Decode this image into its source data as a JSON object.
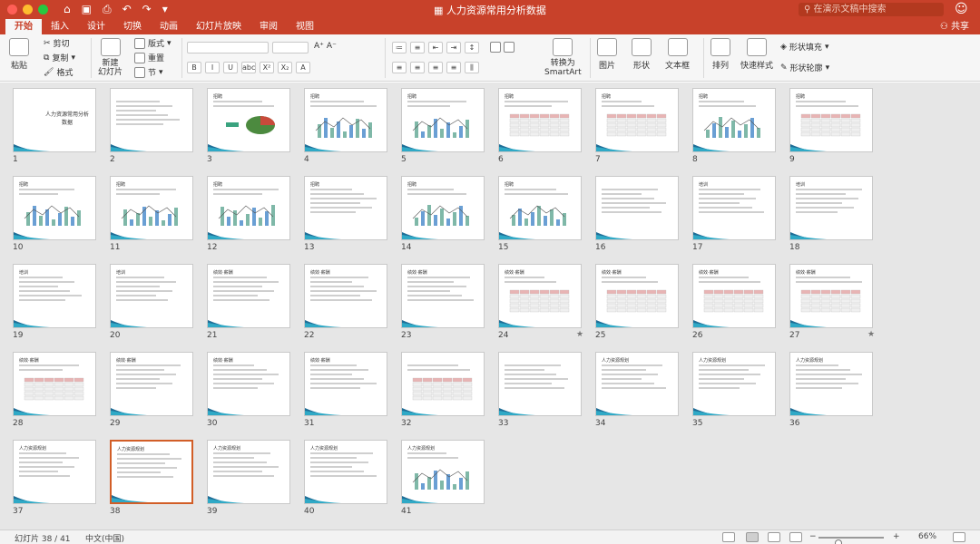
{
  "window": {
    "title": "人力资源常用分析数据",
    "search_placeholder": "在演示文稿中搜索",
    "traffic_colors": [
      "#ff5f57",
      "#febc2e",
      "#28c840"
    ]
  },
  "quick_access": [
    "home-icon",
    "save-icon",
    "print-icon",
    "undo-icon",
    "redo-icon",
    "customize-icon"
  ],
  "tabs": [
    "开始",
    "插入",
    "设计",
    "切换",
    "动画",
    "幻灯片放映",
    "审阅",
    "视图"
  ],
  "active_tab": 0,
  "share_label": "共享",
  "ribbon": {
    "paste": "粘贴",
    "cut": "剪切",
    "copy": "复制",
    "format": "格式",
    "new_slide_line1": "新建",
    "new_slide_line2": "幻灯片",
    "layout": "版式",
    "reset": "重置",
    "section": "节",
    "convert_line1": "转换为",
    "convert_line2": "SmartArt",
    "picture": "图片",
    "shape": "形状",
    "textbox": "文本框",
    "arrange": "排列",
    "quick_styles": "快速样式",
    "shape_fill": "形状填充",
    "shape_outline": "形状轮廓",
    "font_buttons": [
      "B",
      "I",
      "U",
      "abc",
      "X²",
      "X₂"
    ]
  },
  "slides": [
    {
      "num": "1",
      "title": "人力资源常用分析数据",
      "type": "title"
    },
    {
      "num": "2",
      "title": "",
      "type": "text"
    },
    {
      "num": "3",
      "title": "招聘",
      "type": "pie"
    },
    {
      "num": "4",
      "title": "招聘",
      "type": "chart"
    },
    {
      "num": "5",
      "title": "招聘",
      "type": "chart"
    },
    {
      "num": "6",
      "title": "招聘",
      "type": "table"
    },
    {
      "num": "7",
      "title": "招聘",
      "type": "table"
    },
    {
      "num": "8",
      "title": "招聘",
      "type": "chart"
    },
    {
      "num": "9",
      "title": "招聘",
      "type": "table"
    },
    {
      "num": "10",
      "title": "招聘",
      "type": "chart"
    },
    {
      "num": "11",
      "title": "招聘",
      "type": "chart"
    },
    {
      "num": "12",
      "title": "招聘",
      "type": "chart"
    },
    {
      "num": "13",
      "title": "招聘",
      "type": "text"
    },
    {
      "num": "14",
      "title": "招聘",
      "type": "chart"
    },
    {
      "num": "15",
      "title": "招聘",
      "type": "chart"
    },
    {
      "num": "16",
      "title": "",
      "type": "text"
    },
    {
      "num": "17",
      "title": "培训",
      "type": "text"
    },
    {
      "num": "18",
      "title": "培训",
      "type": "text"
    },
    {
      "num": "19",
      "title": "培训",
      "type": "text"
    },
    {
      "num": "20",
      "title": "培训",
      "type": "text"
    },
    {
      "num": "21",
      "title": "绩效·薪酬",
      "type": "text"
    },
    {
      "num": "22",
      "title": "绩效·薪酬",
      "type": "text"
    },
    {
      "num": "23",
      "title": "绩效·薪酬",
      "type": "text"
    },
    {
      "num": "24",
      "title": "绩效·薪酬",
      "type": "table",
      "star": true
    },
    {
      "num": "25",
      "title": "绩效·薪酬",
      "type": "table"
    },
    {
      "num": "26",
      "title": "绩效·薪酬",
      "type": "table"
    },
    {
      "num": "27",
      "title": "绩效·薪酬",
      "type": "table",
      "star": true
    },
    {
      "num": "28",
      "title": "绩效·薪酬",
      "type": "table"
    },
    {
      "num": "29",
      "title": "绩效·薪酬",
      "type": "text"
    },
    {
      "num": "30",
      "title": "绩效·薪酬",
      "type": "text"
    },
    {
      "num": "31",
      "title": "绩效·薪酬",
      "type": "text"
    },
    {
      "num": "32",
      "title": "",
      "type": "table"
    },
    {
      "num": "33",
      "title": "",
      "type": "text"
    },
    {
      "num": "34",
      "title": "人力资源规划",
      "type": "text"
    },
    {
      "num": "35",
      "title": "人力资源规划",
      "type": "text"
    },
    {
      "num": "36",
      "title": "人力资源规划",
      "type": "text"
    },
    {
      "num": "37",
      "title": "人力资源规划",
      "type": "text"
    },
    {
      "num": "38",
      "title": "人力资源规划",
      "type": "text",
      "selected": true
    },
    {
      "num": "39",
      "title": "人力资源规划",
      "type": "text"
    },
    {
      "num": "40",
      "title": "人力资源规划",
      "type": "text"
    },
    {
      "num": "41",
      "title": "人力资源规划",
      "type": "chart"
    }
  ],
  "status": {
    "slide_info": "幻灯片 38 / 41",
    "language": "中文(中国)",
    "zoom_minus": "−",
    "zoom_plus": "+",
    "zoom_level": "66%",
    "zoom_fraction": 0.31
  }
}
